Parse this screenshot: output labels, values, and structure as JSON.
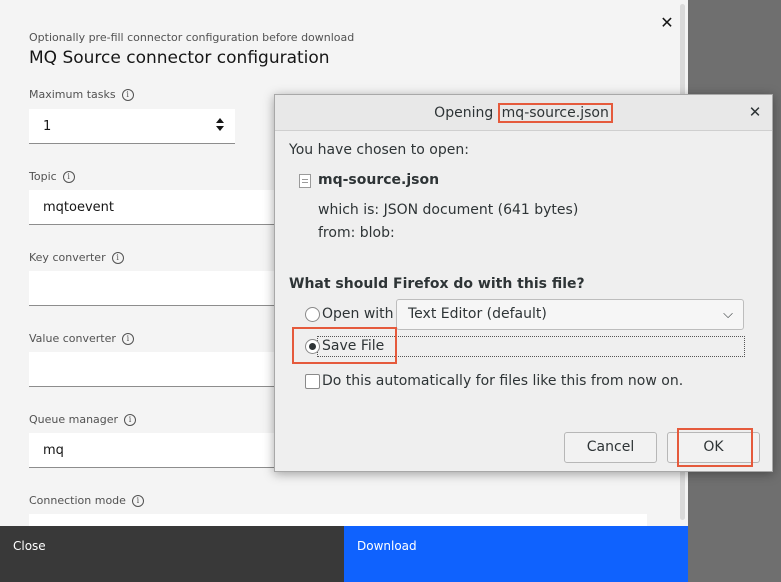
{
  "panel": {
    "pre_label": "Optionally pre-fill connector configuration before download",
    "title": "MQ Source connector configuration",
    "close_icon": "close-icon",
    "fields": [
      {
        "label": "Maximum tasks",
        "value": "1"
      },
      {
        "label": "Topic",
        "value": "mqtoevent"
      },
      {
        "label": "Key converter",
        "value": ""
      },
      {
        "label": "Value converter",
        "value": ""
      },
      {
        "label": "Queue manager",
        "value": "mq"
      },
      {
        "label": "Connection mode",
        "value": ""
      }
    ],
    "info_icon": "info-icon"
  },
  "footer": {
    "close_label": "Close",
    "download_label": "Download"
  },
  "dialog": {
    "title_prefix": "Opening ",
    "title_file": "mq-source.json",
    "chosen_text": "You have chosen to open:",
    "file_name": "mq-source.json",
    "which_is": "which is: JSON document (641 bytes)",
    "from": "from: blob:",
    "question": "What should Firefox do with this file?",
    "open_with_label": "Open with",
    "open_with_app": "Text Editor (default)",
    "save_file_label": "Save File",
    "selected_option": "Save File",
    "auto_label": "Do this automatically for files like this from now on.",
    "auto_checked": false,
    "cancel_label": "Cancel",
    "ok_label": "OK"
  },
  "colors": {
    "primary_button": "#0f62fe",
    "secondary_button": "#393939",
    "annotation_highlight": "#e55a3c"
  }
}
